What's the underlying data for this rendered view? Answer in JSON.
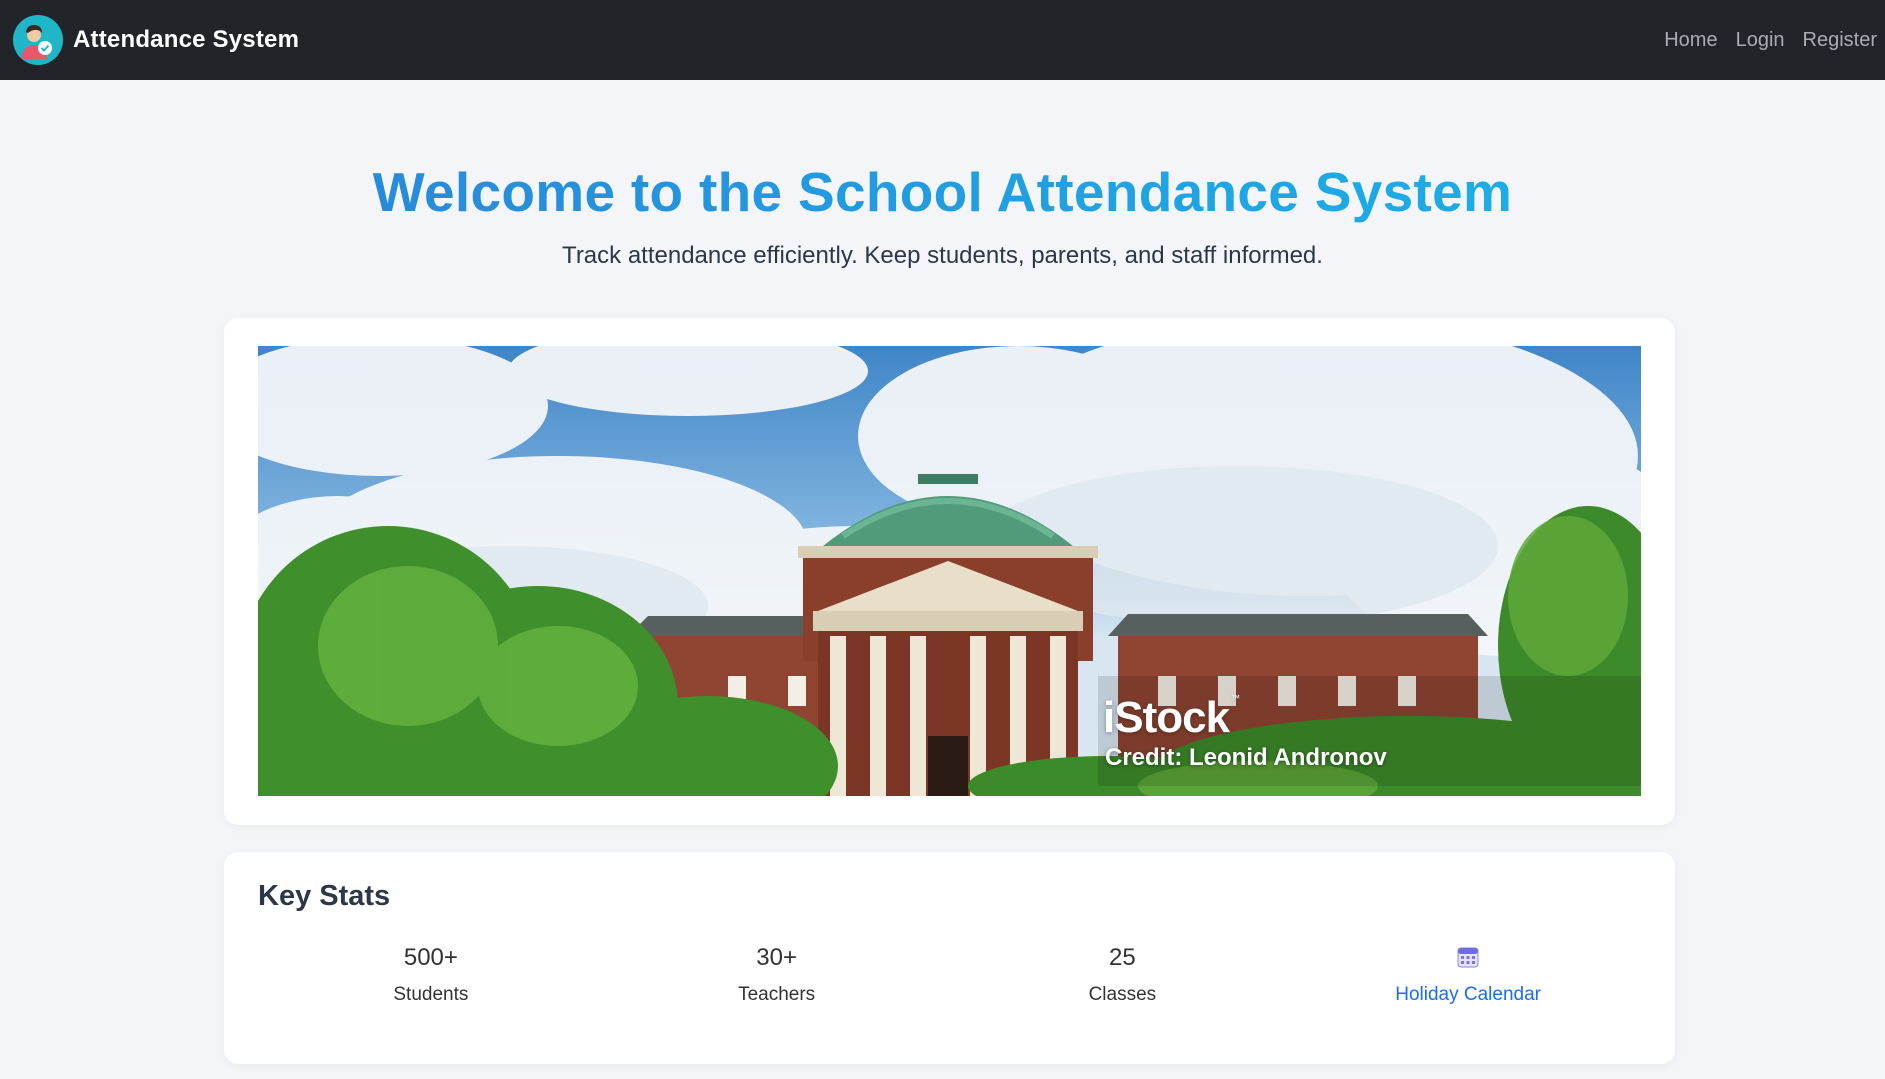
{
  "navbar": {
    "brand": "Attendance System",
    "links": [
      "Home",
      "Login",
      "Register"
    ]
  },
  "hero": {
    "title": "Welcome to the School Attendance System",
    "subtitle": "Track attendance efficiently. Keep students, parents, and staff informed."
  },
  "banner": {
    "watermark": "iStock",
    "trademark": "™",
    "credit": "Credit: Leonid Andronov"
  },
  "stats": {
    "title": "Key Stats",
    "items": [
      {
        "value": "500+",
        "label": "Students"
      },
      {
        "value": "30+",
        "label": "Teachers"
      },
      {
        "value": "25",
        "label": "Classes"
      }
    ],
    "calendar": {
      "icon": "calendar-icon",
      "label": "Holiday Calendar"
    }
  },
  "colors": {
    "navbar": "#212529",
    "title_gradient_start": "#2b7fd6",
    "title_gradient_end": "#19b6ea",
    "link": "#1a6ef0",
    "background": "#f3f5f8"
  }
}
